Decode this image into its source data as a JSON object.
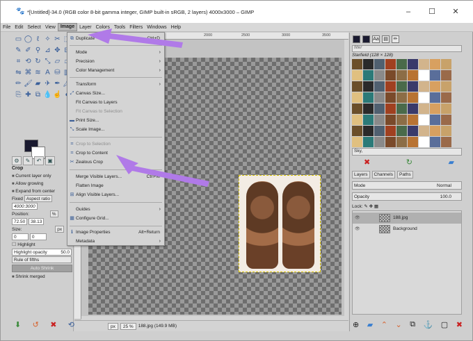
{
  "window": {
    "title": "*[Untitled]-34.0 (RGB color 8-bit gamma integer, GIMP built-in sRGB, 2 layers) 4000x3000 – GIMP",
    "minimize": "–",
    "maximize": "☐",
    "close": "✕"
  },
  "menubar": [
    "File",
    "Edit",
    "Select",
    "View",
    "Image",
    "Layer",
    "Colors",
    "Tools",
    "Filters",
    "Windows",
    "Help"
  ],
  "image_menu": {
    "duplicate": {
      "label": "Duplicate",
      "shortcut": "Ctrl+D"
    },
    "mode": "Mode",
    "precision": "Precision",
    "color_management": "Color Management",
    "transform": "Transform",
    "canvas_size": "Canvas Size...",
    "fit_canvas_layers": "Fit Canvas to Layers",
    "fit_canvas_selection": "Fit Canvas to Selection",
    "print_size": "Print Size...",
    "scale_image": "Scale Image...",
    "crop_to_selection": "Crop to Selection",
    "crop_to_content": "Crop to Content",
    "zealous_crop": "Zealous Crop",
    "merge_visible": {
      "label": "Merge Visible Layers...",
      "shortcut": "Ctrl+M"
    },
    "flatten": "Flatten Image",
    "align_visible": "Align Visible Layers...",
    "guides": "Guides",
    "configure_grid": "Configure Grid...",
    "image_properties": {
      "label": "Image Properties",
      "shortcut": "Alt+Return"
    },
    "metadata": "Metadata"
  },
  "tool_options": {
    "title": "Crop",
    "current_layer_only": "Current layer only",
    "allow_growing": "Allow growing",
    "expand_from_center": "Expand from center",
    "fixed_label": "Fixed",
    "fixed_value": "Aspect ratio",
    "ratio_value": "4000:3000",
    "position_label": "Position:",
    "position_unit": "%",
    "pos_x": "72.50",
    "pos_y": "38.13",
    "size_label": "Size:",
    "size_unit": "px",
    "size_w": "0",
    "size_h": "0",
    "highlight": "Highlight",
    "highlight_opacity_label": "Highlight opacity",
    "highlight_opacity_value": "50.0",
    "guides_value": "Rule of fifths",
    "auto_shrink": "Auto Shrink",
    "shrink_merged": "Shrink merged"
  },
  "ruler": {
    "m1": "2000",
    "m2": "2500",
    "m3": "3000",
    "m4": "3500"
  },
  "statusbar": {
    "unit": "px",
    "zoom": "25 %",
    "info": "188.jpg (149.9 MB)"
  },
  "dock": {
    "filter_placeholder": "filter",
    "pattern_name": "Starfield (128 × 128)",
    "pattern_current": "Sky,",
    "tabs": [
      "Layers",
      "Channels",
      "Paths"
    ],
    "mode_label": "Mode",
    "mode_value": "Normal",
    "opacity_label": "Opacity",
    "opacity_value": "100.0",
    "lock_label": "Lock:",
    "layers": [
      {
        "name": "188.jpg",
        "selected": true
      },
      {
        "name": "Background",
        "selected": false
      }
    ]
  },
  "colors": {
    "accent_arrow": "#b07ae8",
    "selection_highlight": "#b0b0b0",
    "canvas_checker_dark": "#6e6e6e",
    "canvas_checker_light": "#9a9a9a"
  }
}
